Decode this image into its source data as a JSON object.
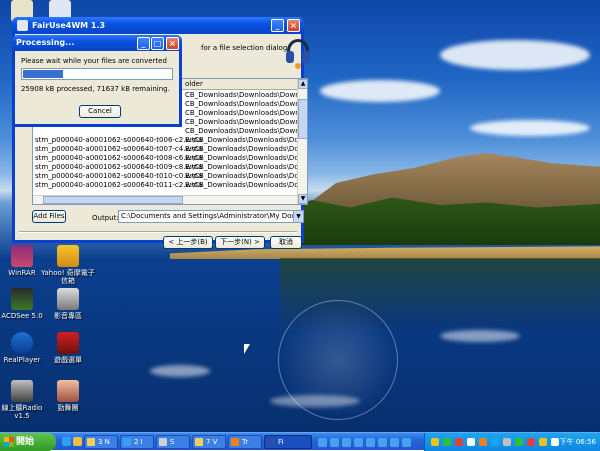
{
  "desktop": {
    "icons": [
      {
        "name": "desktop-icon-top-1",
        "label": ""
      },
      {
        "name": "desktop-icon-top-2",
        "label": ""
      },
      {
        "name": "desktop-icon-winrar",
        "label": "WinRAR"
      },
      {
        "name": "desktop-icon-yahoo",
        "label": "Yahoo! 奇摩電子信箱"
      },
      {
        "name": "desktop-icon-acdsee",
        "label": "ACDSee 5.0"
      },
      {
        "name": "desktop-icon-yingyin",
        "label": "影音專區"
      },
      {
        "name": "desktop-icon-realplayer",
        "label": "RealPlayer"
      },
      {
        "name": "desktop-icon-game",
        "label": "遊戲選單"
      },
      {
        "name": "desktop-icon-radio",
        "label": "線上聽Radio v1.5"
      },
      {
        "name": "desktop-icon-dance",
        "label": "勁舞團"
      }
    ]
  },
  "main_window": {
    "title": "FairUse4WM 1.3",
    "description": "for a file selection dialog.",
    "list_header_folder": "older",
    "files": [
      {
        "name": "",
        "folder": "CB_Downloads\\Downloads\\Download"
      },
      {
        "name": "",
        "folder": "CB_Downloads\\Downloads\\Download"
      },
      {
        "name": "",
        "folder": "CB_Downloads\\Downloads\\Download"
      },
      {
        "name": "",
        "folder": "CB_Downloads\\Downloads\\Download"
      },
      {
        "name": "",
        "folder": "CB_Downloads\\Downloads\\Download"
      },
      {
        "name": "stm_p000040-a0001062-s000640-t006-c2.wma",
        "folder": "E:\\CB_Downloads\\Downloads\\Download"
      },
      {
        "name": "stm_p000040-a0001062-s000640-t007-c4.wma",
        "folder": "E:\\CB_Downloads\\Downloads\\Download"
      },
      {
        "name": "stm_p000040-a0001062-s000640-t008-c6.wma",
        "folder": "E:\\CB_Downloads\\Downloads\\Download"
      },
      {
        "name": "stm_p000040-a0001062-s000640-t009-c8.wma",
        "folder": "E:\\CB_Downloads\\Downloads\\Download"
      },
      {
        "name": "stm_p000040-a0001062-s000640-t010-c0.wma",
        "folder": "E:\\CB_Downloads\\Downloads\\Download"
      },
      {
        "name": "stm_p000040-a0001062-s000640-t011-c2.wma",
        "folder": "E:\\CB_Downloads\\Downloads\\Download"
      }
    ],
    "add_files_label": "Add Files",
    "output_label": "Output:",
    "output_path": "C:\\Documents and Settings\\Administrator\\My Documents\\My V",
    "back_label": "< 上一步(B)",
    "next_label": "下一步(N) >",
    "cancel_label": "取消"
  },
  "processing_dialog": {
    "title": "Processing...",
    "message": "Please wait while your files are converted",
    "progress_fraction": 0.27,
    "status": "25908 kB processed, 71637 kB remaining.",
    "cancel_label": "Cancel"
  },
  "taskbar": {
    "start_label": "開始",
    "tasks": [
      {
        "name": "task-1",
        "label": "3 N"
      },
      {
        "name": "task-2",
        "label": "2 I"
      },
      {
        "name": "task-3",
        "label": "S"
      },
      {
        "name": "task-4",
        "label": "7 V"
      },
      {
        "name": "task-5",
        "label": "Tr"
      },
      {
        "name": "task-6",
        "label": "Fi"
      }
    ],
    "clock": "下午 06:56"
  },
  "colors": {
    "xp_blue": "#0a52e0",
    "progress": "#3a6ed0",
    "start_green": "#2e9a24"
  }
}
